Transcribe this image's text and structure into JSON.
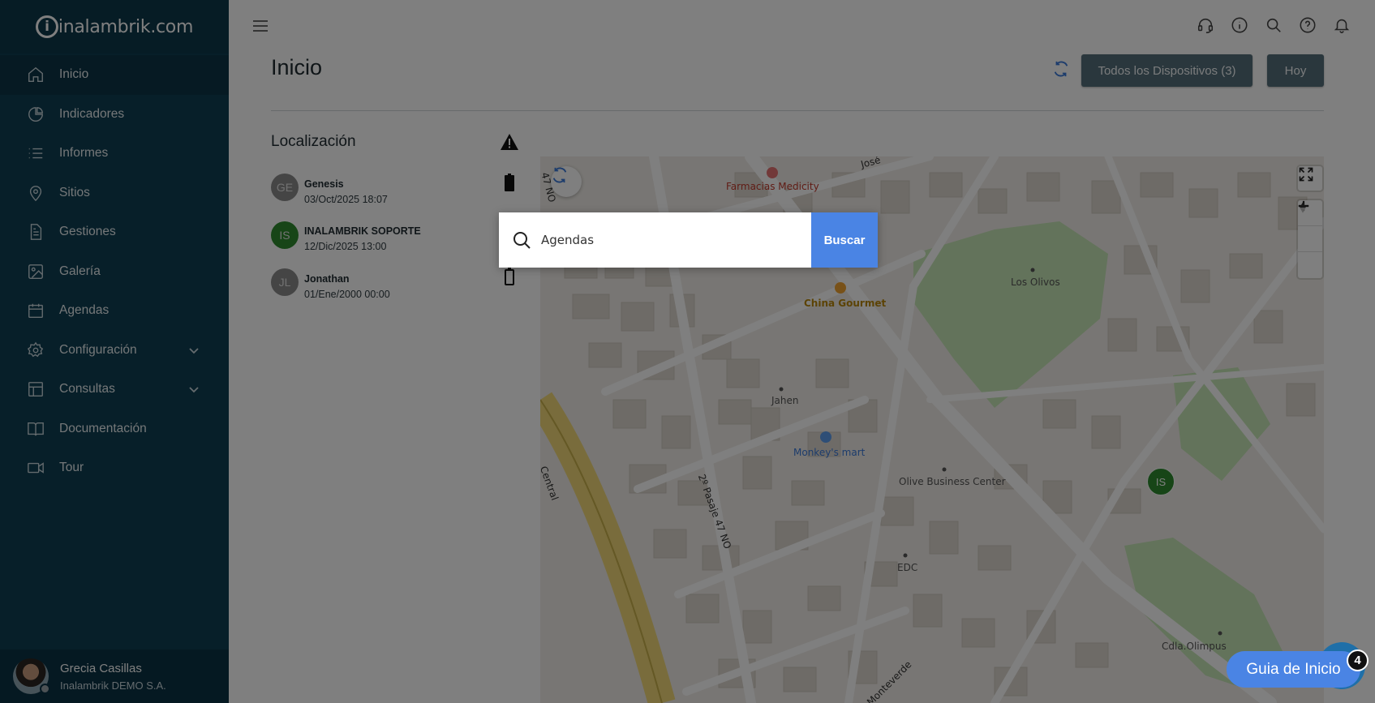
{
  "app": {
    "logo_text": "inalambrik.com",
    "logo_letter": "i"
  },
  "sidebar": {
    "items": [
      {
        "label": "Inicio",
        "icon": "home-icon",
        "active": true
      },
      {
        "label": "Indicadores",
        "icon": "pie-chart-icon"
      },
      {
        "label": "Informes",
        "icon": "list-icon"
      },
      {
        "label": "Sitios",
        "icon": "location-pin-icon"
      },
      {
        "label": "Gestiones",
        "icon": "document-icon"
      },
      {
        "label": "Galería",
        "icon": "image-icon"
      },
      {
        "label": "Agendas",
        "icon": "calendar-icon"
      },
      {
        "label": "Configuración",
        "icon": "gear-icon",
        "expandable": true
      },
      {
        "label": "Consultas",
        "icon": "table-icon",
        "expandable": true
      },
      {
        "label": "Documentación",
        "icon": "book-icon"
      },
      {
        "label": "Tour",
        "icon": "video-icon"
      }
    ],
    "user": {
      "name": "Grecia Casillas",
      "company": "Inalambrik DEMO S.A."
    }
  },
  "header": {
    "title": "Inicio",
    "devices_button": "Todos los Dispositivos (3)",
    "date_button": "Hoy",
    "icons": [
      "headset-icon",
      "info-icon",
      "search-icon",
      "help-icon",
      "bell-icon"
    ]
  },
  "location": {
    "title": "Localización",
    "devices": [
      {
        "initials": "GE",
        "name": "Genesis",
        "date": "03/Oct/2025 18:07",
        "color": "#8a8a8a"
      },
      {
        "initials": "IS",
        "name": "INALAMBRIK SOPORTE",
        "date": "12/Dic/2025 13:00",
        "color": "#2e8b2e"
      },
      {
        "initials": "JL",
        "name": "Jonathan",
        "date": "01/Ene/2000 00:00",
        "color": "#8a8a8a"
      }
    ]
  },
  "map": {
    "labels": {
      "farmacias": "Farmacias Medicity",
      "china": "China Gourmet",
      "los_olivos": "Los Olivos",
      "jahen": "Jahen",
      "monkeys": "Monkey's mart",
      "olive": "Olive Business Center",
      "edc": "EDC",
      "cdla": "Cdla.Olimpus",
      "pasaje": "2º Pasaje 47 NO",
      "central": "Central",
      "monteverde": "Monteverde",
      "n47": "47 NO",
      "jose": "José"
    },
    "marker": "IS"
  },
  "search": {
    "value": "Agendas",
    "button": "Buscar"
  },
  "guide": {
    "label": "Guia de Inicio",
    "badge": "4"
  },
  "colors": {
    "sidebar_bg": "#0f3e52",
    "button_dark": "#546e7a",
    "accent_blue": "#4a84e4",
    "marker_green": "#2e8b2e"
  }
}
